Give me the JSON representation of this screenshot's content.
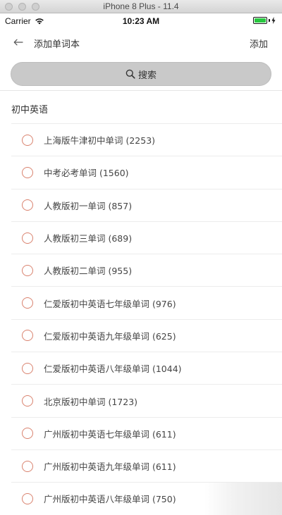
{
  "simulator": {
    "title": "iPhone 8 Plus - 11.4"
  },
  "status_bar": {
    "carrier": "Carrier",
    "time": "10:23 AM"
  },
  "nav": {
    "title": "添加单词本",
    "action_label": "添加"
  },
  "search": {
    "label": "搜索"
  },
  "section": {
    "title": "初中英语"
  },
  "items": [
    {
      "label": "上海版牛津初中单词 (2253)"
    },
    {
      "label": "中考必考单词 (1560)"
    },
    {
      "label": "人教版初一单词 (857)"
    },
    {
      "label": "人教版初三单词 (689)"
    },
    {
      "label": "人教版初二单词 (955)"
    },
    {
      "label": "仁爱版初中英语七年级单词 (976)"
    },
    {
      "label": "仁爱版初中英语九年级单词 (625)"
    },
    {
      "label": "仁爱版初中英语八年级单词 (1044)"
    },
    {
      "label": "北京版初中单词 (1723)"
    },
    {
      "label": "广州版初中英语七年级单词 (611)"
    },
    {
      "label": "广州版初中英语九年级单词 (611)"
    },
    {
      "label": "广州版初中英语八年级单词 (750)"
    }
  ],
  "colors": {
    "radio_border": "#d9826e",
    "search_bg": "#c9c9c9",
    "battery": "#28c840"
  }
}
